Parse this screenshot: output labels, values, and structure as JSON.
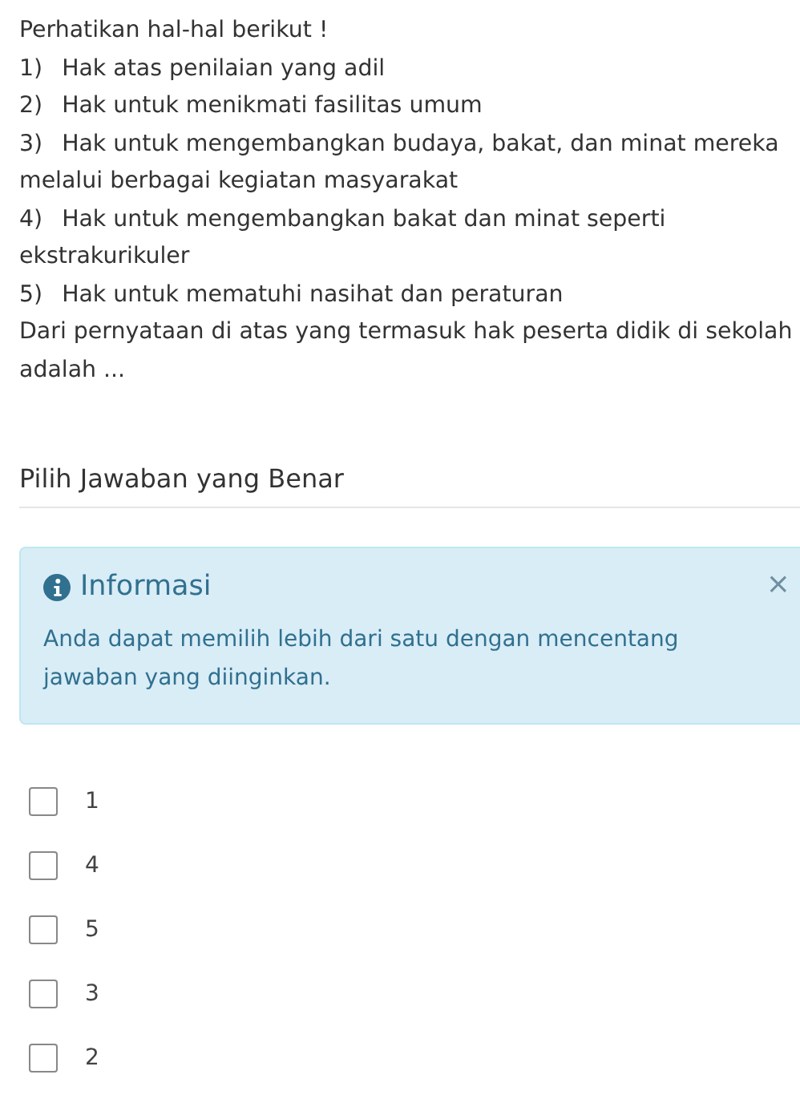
{
  "question": {
    "intro": "Perhatikan hal-hal berikut !",
    "items": [
      {
        "number": "1)",
        "text": "Hak atas penilaian yang adil"
      },
      {
        "number": "2)",
        "text": "Hak untuk menikmati fasilitas umum"
      },
      {
        "number": "3)",
        "text": "Hak untuk mengembangkan budaya, bakat, dan minat mereka melalui berbagai kegiatan masyarakat"
      },
      {
        "number": "4)",
        "text": "Hak untuk mengembangkan bakat dan minat seperti ekstrakurikuler"
      },
      {
        "number": "5)",
        "text": "Hak untuk mematuhi nasihat dan peraturan"
      }
    ],
    "prompt": "Dari pernyataan di atas yang termasuk hak peserta didik di sekolah adalah ..."
  },
  "answer_heading": "Pilih Jawaban yang Benar",
  "alert": {
    "title": "Informasi",
    "close": "×",
    "message": "Anda dapat memilih lebih dari satu dengan mencentang jawaban yang diinginkan."
  },
  "options": [
    {
      "label": "1",
      "checked": false
    },
    {
      "label": "4",
      "checked": false
    },
    {
      "label": "5",
      "checked": false
    },
    {
      "label": "3",
      "checked": false
    },
    {
      "label": "2",
      "checked": false
    }
  ]
}
